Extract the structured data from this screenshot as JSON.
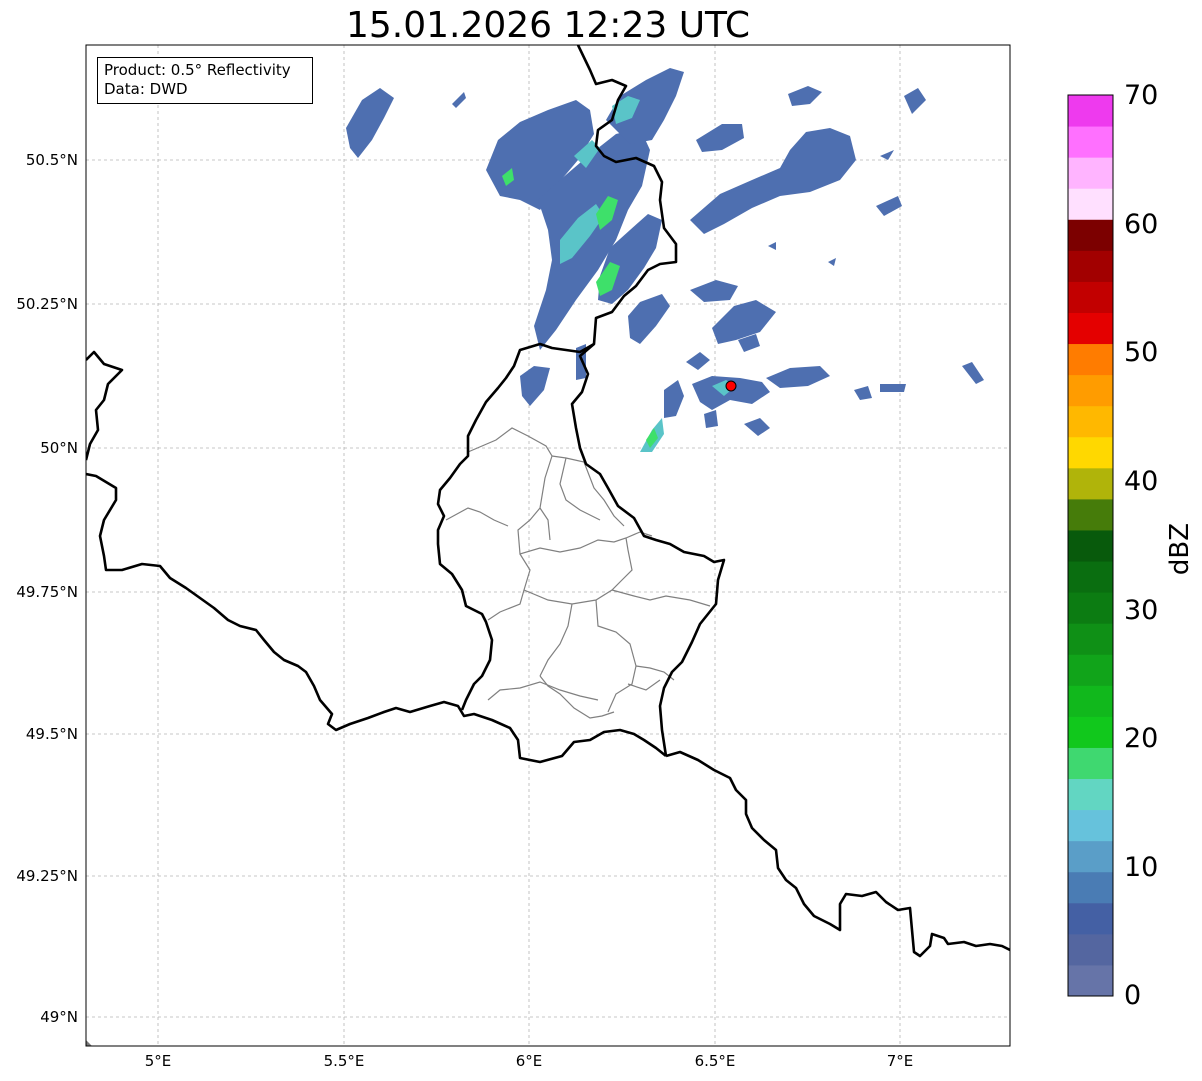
{
  "title": "15.01.2026 12:23 UTC",
  "info_box": {
    "product": "Product: 0.5° Reflectivity",
    "data": "Data: DWD"
  },
  "axes": {
    "lon_ticks": [
      "5°E",
      "5.5°E",
      "6°E",
      "6.5°E",
      "7°E"
    ],
    "lat_ticks": [
      "50.5°N",
      "50.25°N",
      "50°N",
      "49.75°N",
      "49.5°N",
      "49.25°N",
      "49°N"
    ],
    "lon_range": [
      4.8,
      7.3
    ],
    "lat_range": [
      48.95,
      50.7
    ]
  },
  "colorbar": {
    "label": "dBZ",
    "tick_labels": [
      "0",
      "10",
      "20",
      "30",
      "40",
      "50",
      "60",
      "70"
    ],
    "range": [
      0,
      70
    ],
    "colors": [
      "#6674a8",
      "#5466a0",
      "#4460a4",
      "#4a7cb4",
      "#5a9ec8",
      "#66c2dc",
      "#62d6c2",
      "#3fd870",
      "#11c81c",
      "#11b81c",
      "#11a41a",
      "#0f9016",
      "#0c7c12",
      "#0a6e10",
      "#085a0c",
      "#467c0a",
      "#b0b40a",
      "#ffd800",
      "#ffb800",
      "#ff9c00",
      "#ff7c00",
      "#e40000",
      "#c20000",
      "#a20000",
      "#7c0000",
      "#ffe0ff",
      "#ffb4ff",
      "#ff70ff",
      "#ee3aee"
    ]
  },
  "site_marker": "radar-site-marker",
  "colors": {
    "low_echo": "#4e6fb0",
    "mid_echo": "#5ac4c8",
    "high_echo": "#3ee06a",
    "border_national": "#000000",
    "border_admin": "#808080",
    "grid": "#b0b0b0",
    "site_marker": "#ff0000"
  }
}
